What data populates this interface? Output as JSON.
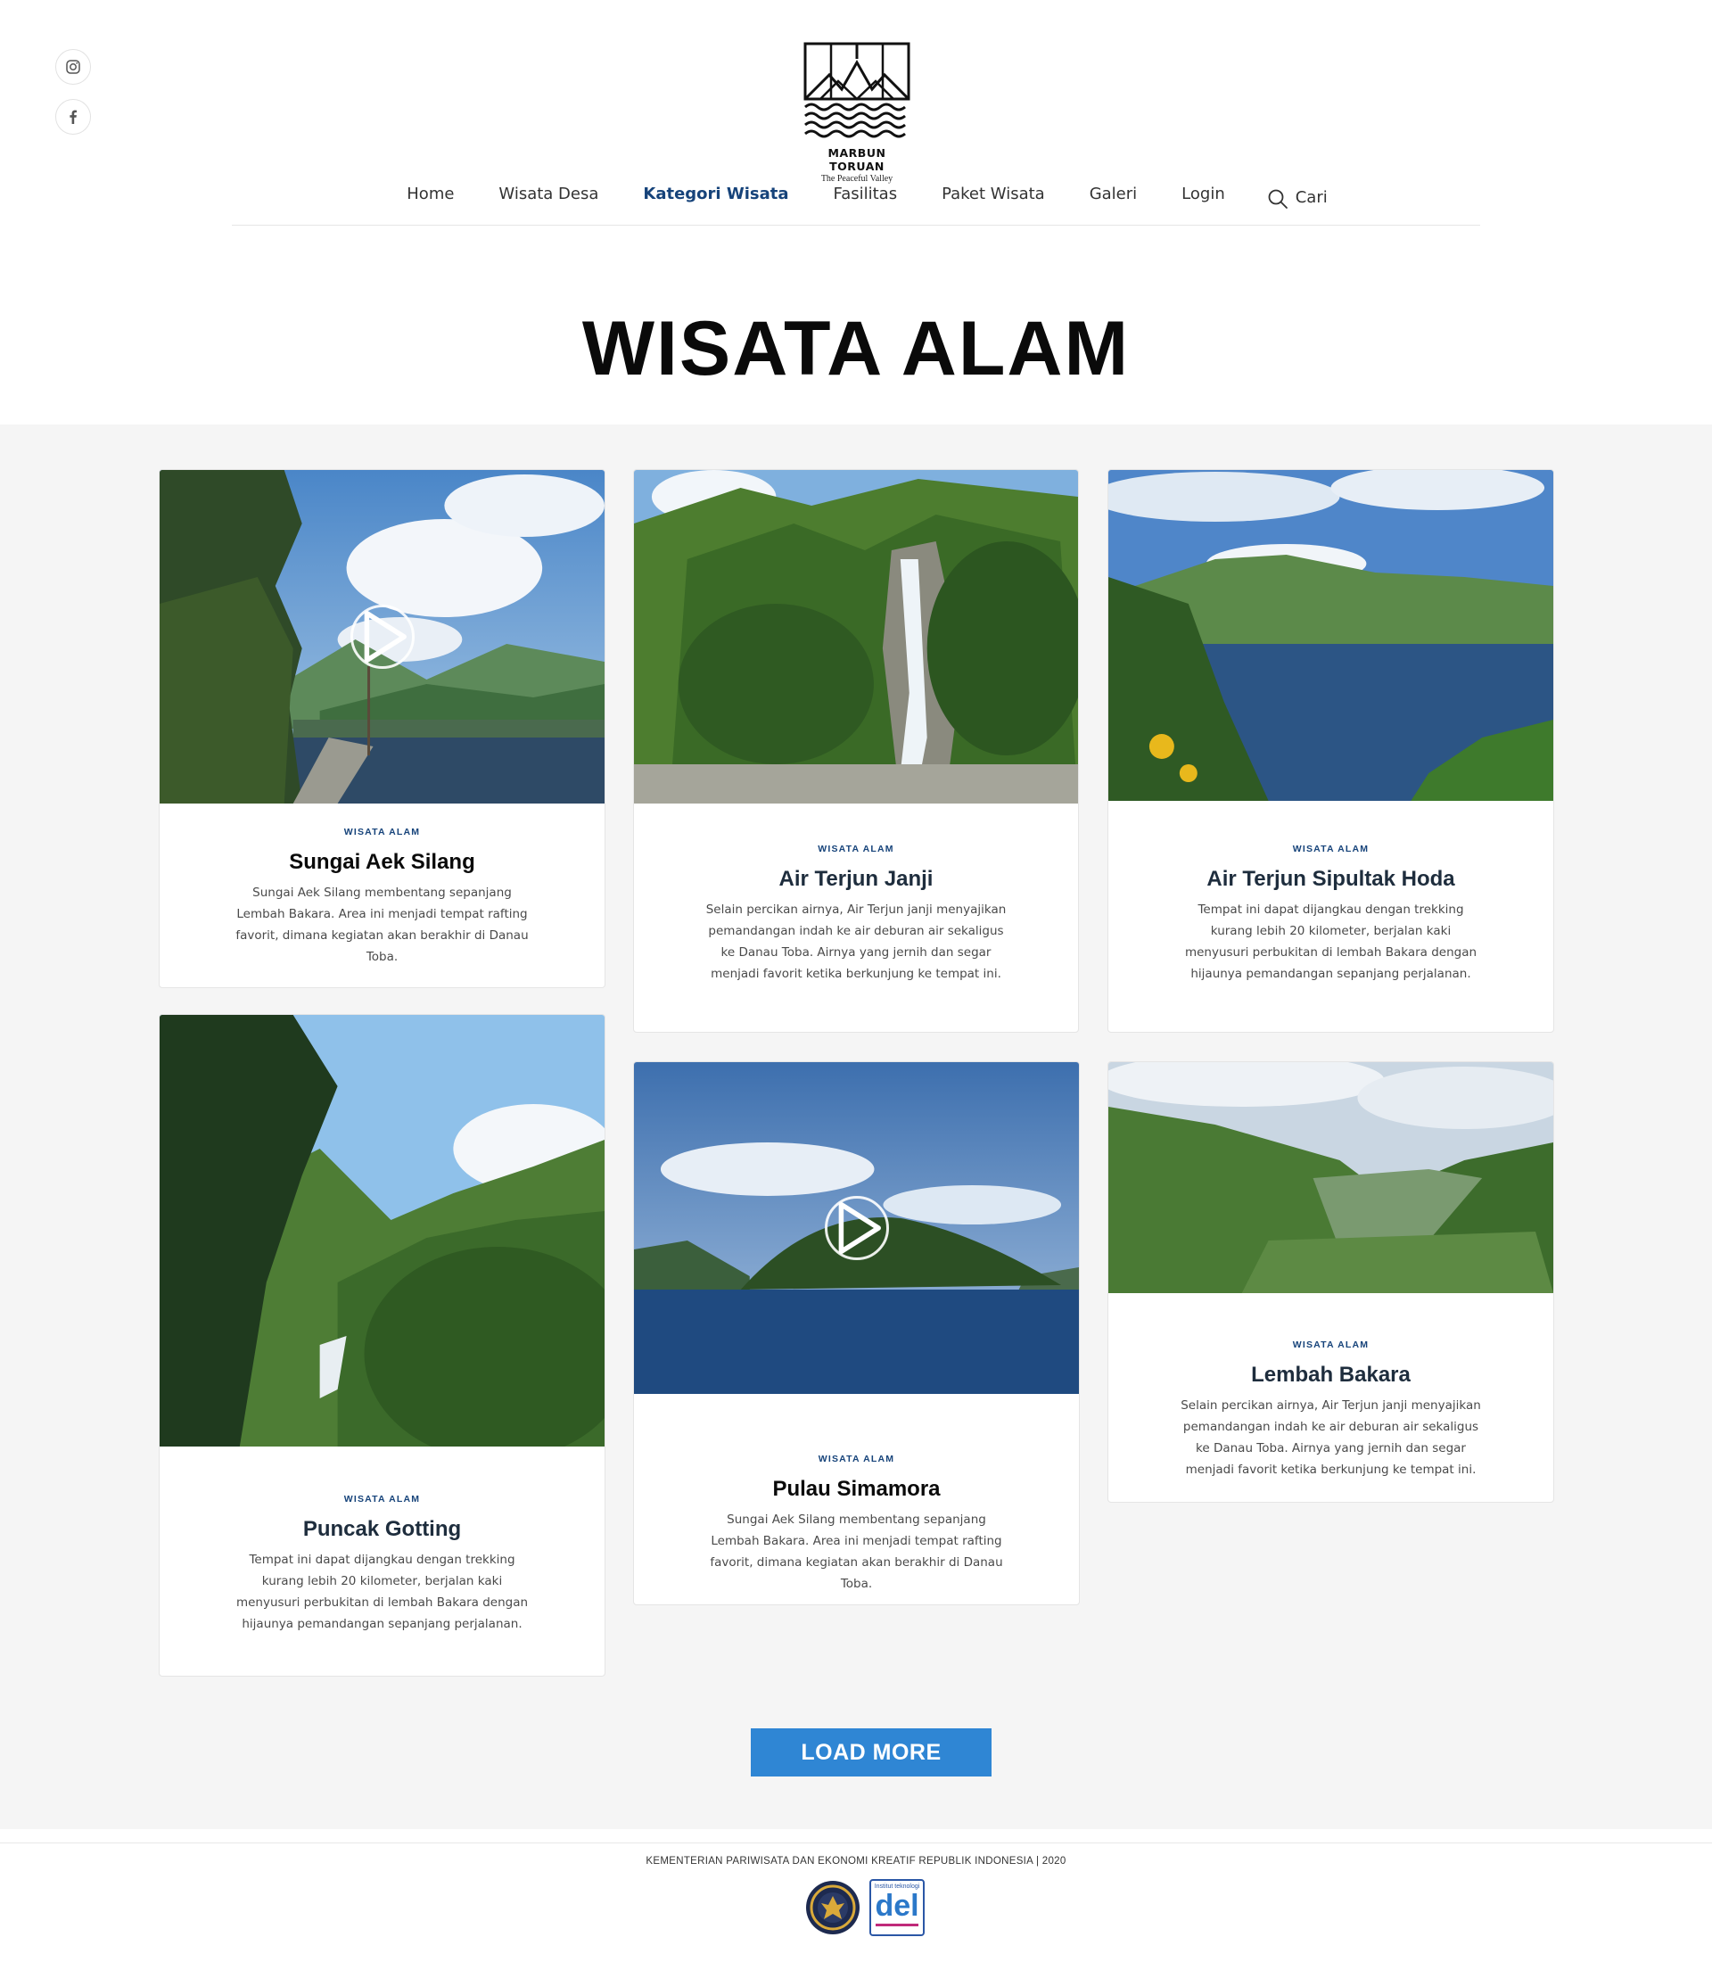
{
  "site": {
    "name": "MARBUN TORUAN",
    "tagline": "The Peaceful Valley"
  },
  "social": {
    "icons": [
      "instagram-icon",
      "facebook-icon"
    ]
  },
  "nav": {
    "items": [
      "Home",
      "Wisata Desa",
      "Kategori Wisata",
      "Fasilitas",
      "Paket Wisata",
      "Galeri",
      "Login"
    ],
    "active": "Kategori Wisata",
    "search_label": "Cari"
  },
  "page": {
    "title": "WISATA ALAM"
  },
  "cards": [
    {
      "category": "WISATA ALAM",
      "title": "Sungai Aek Silang",
      "description": "Sungai Aek Silang membentang sepanjang Lembah Bakara. Area ini menjadi tempat rafting favorit, dimana kegiatan akan berakhir di Danau Toba.",
      "has_video": true
    },
    {
      "category": "WISATA ALAM",
      "title": "Air Terjun Janji",
      "description": "Selain percikan airnya, Air Terjun janji menyajikan pemandangan indah ke air deburan air sekaligus ke Danau Toba. Airnya yang jernih dan segar menjadi favorit ketika berkunjung ke tempat ini.",
      "has_video": false
    },
    {
      "category": "WISATA ALAM",
      "title": "Air Terjun Sipultak Hoda",
      "description": "Tempat ini dapat dijangkau dengan trekking kurang lebih 20 kilometer, berjalan kaki menyusuri perbukitan di lembah Bakara dengan hijaunya pemandangan sepanjang perjalanan.",
      "has_video": false
    },
    {
      "category": "WISATA ALAM",
      "title": "Puncak Gotting",
      "description": "Tempat ini dapat dijangkau dengan trekking kurang lebih 20 kilometer, berjalan kaki menyusuri perbukitan di lembah Bakara dengan hijaunya pemandangan sepanjang perjalanan.",
      "has_video": false
    },
    {
      "category": "WISATA ALAM",
      "title": "Pulau Simamora",
      "description": "Sungai Aek Silang membentang sepanjang Lembah Bakara. Area ini menjadi tempat rafting favorit, dimana kegiatan akan berakhir di Danau Toba.",
      "has_video": true
    },
    {
      "category": "WISATA ALAM",
      "title": "Lembah Bakara",
      "description": "Selain percikan airnya, Air Terjun janji menyajikan pemandangan indah ke air deburan air sekaligus ke Danau Toba. Airnya yang jernih dan segar menjadi favorit ketika berkunjung ke tempat ini.",
      "has_video": false
    }
  ],
  "load_more_label": "LOAD MORE",
  "footer": {
    "text": "KEMENTERIAN PARIWISATA DAN EKONOMI KREATIF REPUBLIK INDONESIA | 2020",
    "del_label": "del",
    "del_caption": "Institut teknologi"
  },
  "colors": {
    "accent": "#16437a",
    "button": "#2f86d4",
    "section_bg": "#f5f5f5"
  }
}
